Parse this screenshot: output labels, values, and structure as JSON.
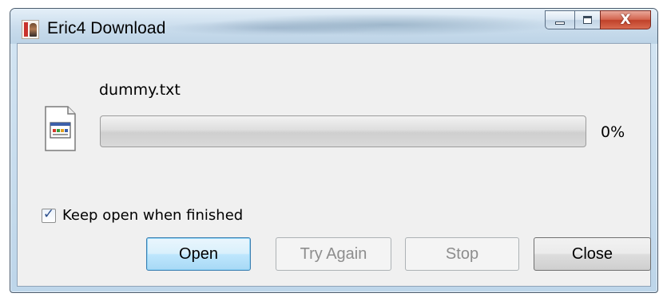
{
  "window": {
    "title": "Eric4 Download",
    "app_icon": "eric-logo-icon",
    "caption_buttons": {
      "minimize": "minimize-icon",
      "maximize": "maximize-icon",
      "close_glyph": "X"
    }
  },
  "download": {
    "filename": "dummy.txt",
    "file_icon": "document-icon",
    "progress_fraction": 0,
    "progress_text": "0%"
  },
  "options": {
    "keep_open_label": "Keep open when finished",
    "keep_open_checked": true
  },
  "buttons": {
    "open": "Open",
    "try_again": "Try Again",
    "stop": "Stop",
    "close": "Close"
  },
  "colors": {
    "close_button_red": "#c0412a",
    "default_button_blue": "#3c7fb1",
    "progress_green": "#4ec23a"
  }
}
